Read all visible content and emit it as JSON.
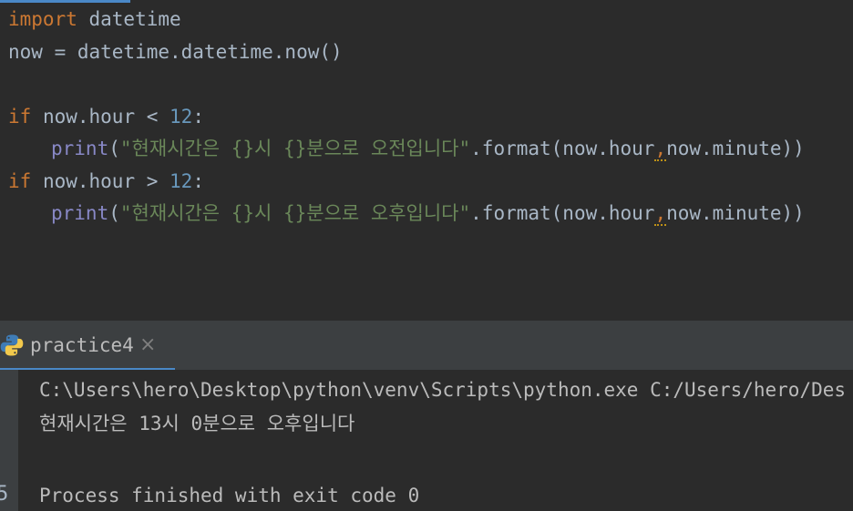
{
  "editor": {
    "lines": [
      {
        "kw": "import",
        "rest": " datetime"
      },
      {
        "text": "now = datetime.datetime.now()"
      },
      {
        "text": ""
      },
      {
        "kw": "if",
        "cond": " now.hour < ",
        "num": "12",
        "colon": ":"
      },
      {
        "fn": "print",
        "open": "(",
        "str": "\"현재시간은 {}시 {}분으로 오전입니다\"",
        "call": ".format(now.hour",
        "comma": ",",
        "tail": "now.minute))"
      },
      {
        "kw": "if",
        "cond": " now.hour > ",
        "num": "12",
        "colon": ":"
      },
      {
        "fn": "print",
        "open": "(",
        "str": "\"현재시간은 {}시 {}분으로 오후입니다\"",
        "call": ".format(now.hour",
        "comma": ",",
        "tail": "now.minute))"
      }
    ]
  },
  "run": {
    "tab_label": "practice4",
    "close_glyph": "×",
    "gutter_partial": "5",
    "console": [
      "C:\\Users\\hero\\Desktop\\python\\venv\\Scripts\\python.exe C:/Users/hero/Des",
      "현재시간은 13시 0분으로 오후입니다",
      "",
      "Process finished with exit code 0"
    ]
  },
  "colors": {
    "background": "#2b2b2b",
    "keyword": "#cc7832",
    "number": "#6897bb",
    "builtin": "#8888c6",
    "string": "#6a8759",
    "default_text": "#a9b7c6",
    "accent": "#4a88c7"
  },
  "icons": {
    "run_tab": "python-icon",
    "close": "close-icon"
  }
}
